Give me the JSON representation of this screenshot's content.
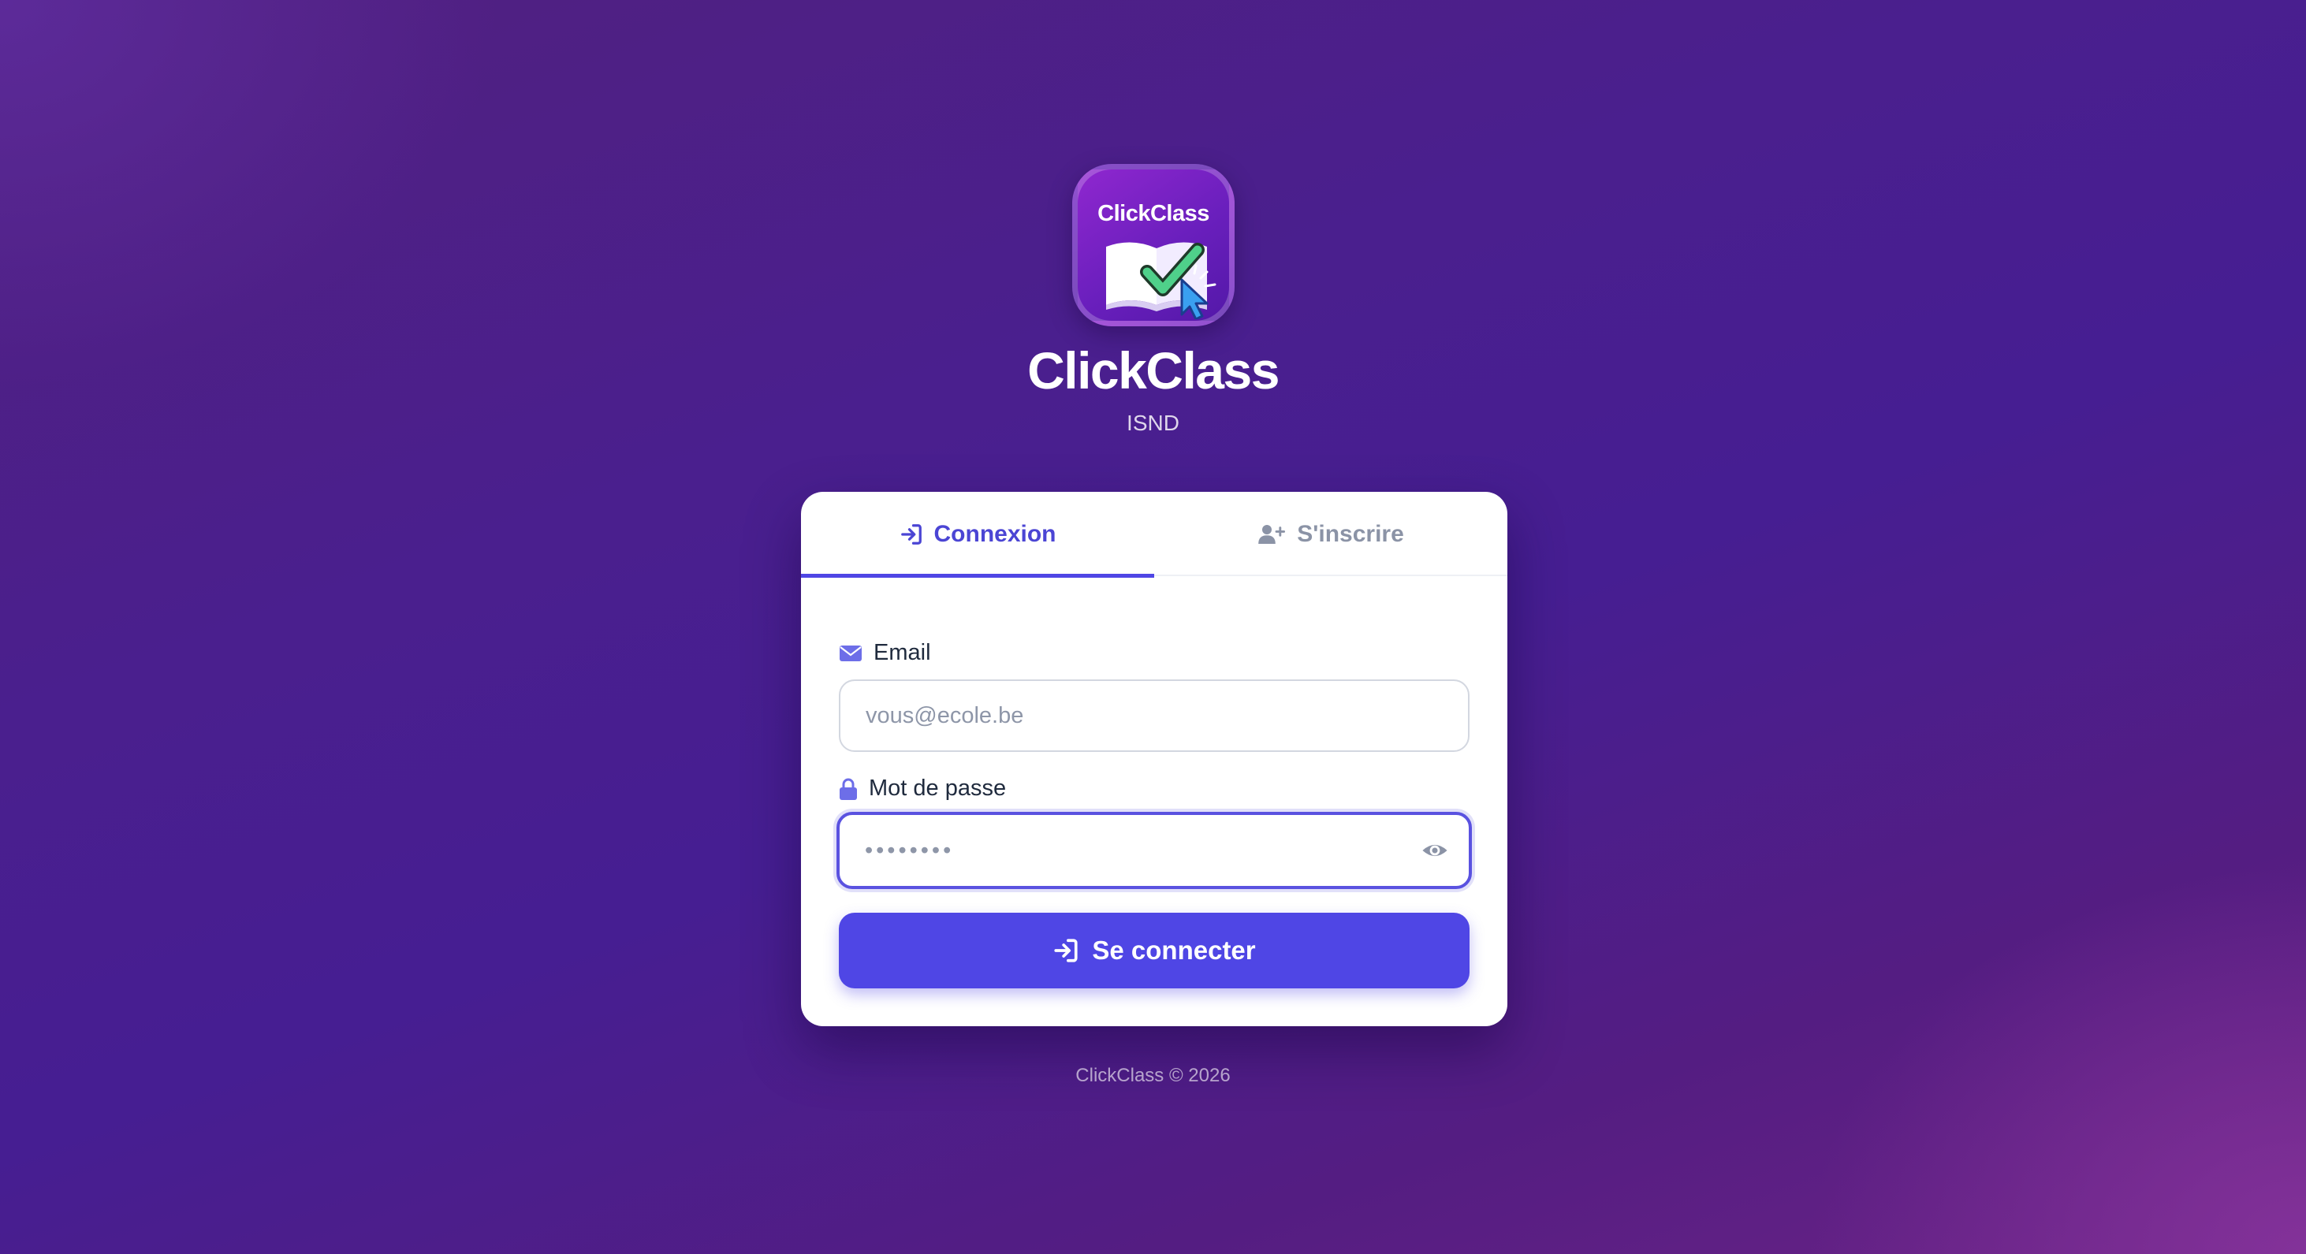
{
  "logo": {
    "tile_text": "ClickClass",
    "icon": "book-check-cursor-icon"
  },
  "header": {
    "title": "ClickClass",
    "subtitle": "ISND"
  },
  "tabs": [
    {
      "label": "Connexion",
      "icon": "sign-in-icon",
      "active": true
    },
    {
      "label": "S'inscrire",
      "icon": "user-plus-icon",
      "active": false
    }
  ],
  "form": {
    "email": {
      "label": "Email",
      "icon": "envelope-icon",
      "placeholder": "vous@ecole.be",
      "value": ""
    },
    "password": {
      "label": "Mot de passe",
      "icon": "lock-icon",
      "placeholder": "••••••••",
      "value": ""
    },
    "submit_label": "Se connecter"
  },
  "footer": {
    "text": "ClickClass © 2026"
  },
  "colors": {
    "accent": "#4f46e5",
    "background_start": "#51207f",
    "background_end": "#6a2386"
  }
}
